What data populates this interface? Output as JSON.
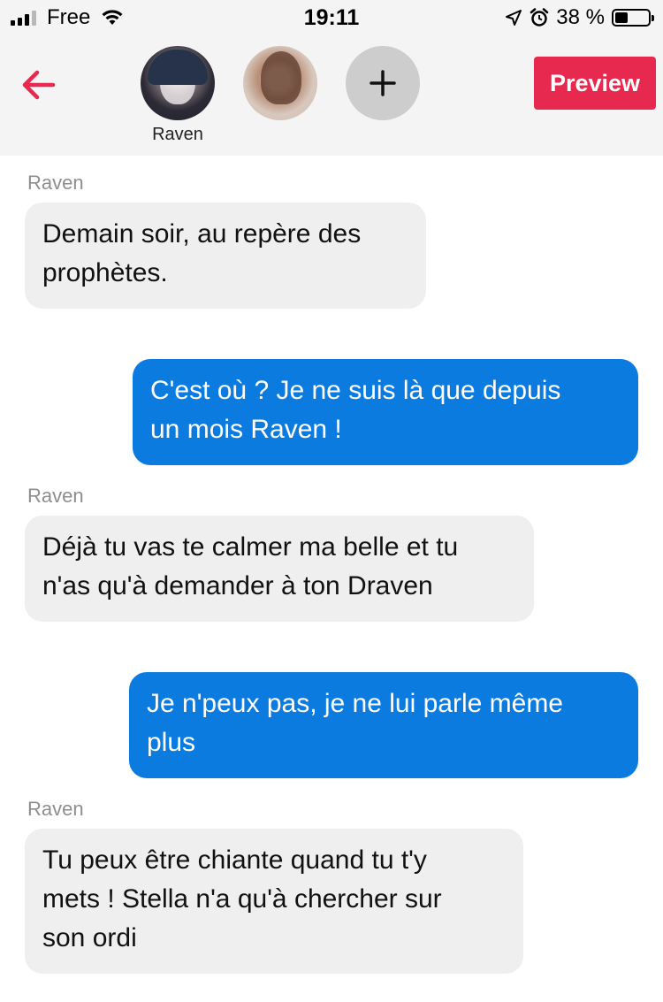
{
  "status_bar": {
    "carrier": "Free",
    "time": "19:11",
    "battery_text": "38 %",
    "battery_level": 0.38,
    "signal_icon": "signal-bars-icon",
    "wifi_icon": "wifi-icon",
    "location_icon": "location-arrow-icon",
    "alarm_icon": "alarm-clock-icon"
  },
  "header": {
    "back_icon": "arrow-left-icon",
    "avatars": [
      {
        "name": "Raven"
      },
      {
        "name": ""
      }
    ],
    "add_label": "+",
    "preview_label": "Preview",
    "accent_color": "#e8294f"
  },
  "messages": [
    {
      "side": "in",
      "sender": "Raven",
      "text": "Demain soir, au repère des\nprophètes."
    },
    {
      "side": "out",
      "text": "C'est où ? Je ne suis là que depuis\nun mois Raven !"
    },
    {
      "side": "in",
      "sender": "Raven",
      "text": "Déjà tu vas te calmer ma belle et tu\nn'as qu'à demander à ton Draven"
    },
    {
      "side": "out",
      "text": "Je n'peux pas, je ne lui parle même\nplus"
    },
    {
      "side": "in",
      "sender": "Raven",
      "text": "Tu peux être chiante quand tu t'y\nmets ! Stella n'a qu'à chercher sur\nson ordi"
    }
  ],
  "colors": {
    "outgoing_bubble": "#0b7be0",
    "incoming_bubble": "#efefef",
    "header_bg": "#f4f4f4"
  }
}
